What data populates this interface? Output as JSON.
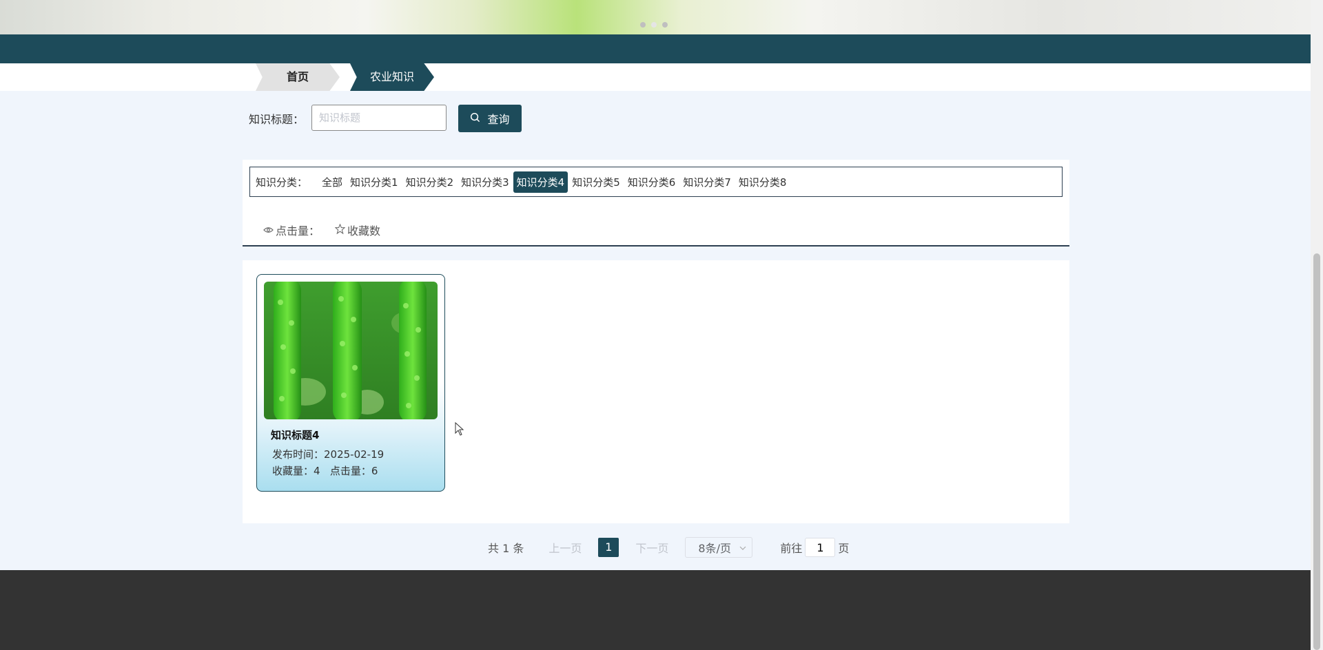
{
  "banner": {
    "slide_count": 3,
    "active_slide": 2
  },
  "breadcrumb": {
    "home": "首页",
    "current": "农业知识"
  },
  "search": {
    "label": "知识标题：",
    "placeholder": "知识标题",
    "value": "",
    "button_label": "查询"
  },
  "categories": {
    "label": "知识分类：",
    "items": [
      "全部",
      "知识分类1",
      "知识分类2",
      "知识分类3",
      "知识分类4",
      "知识分类5",
      "知识分类6",
      "知识分类7",
      "知识分类8"
    ],
    "active_index": 4
  },
  "sort": {
    "clicks": "点击量：",
    "favorites": "收藏数"
  },
  "card": {
    "title": "知识标题4",
    "publish_time": "发布时间：2025-02-19",
    "stats": "收藏量：4   点击量：6"
  },
  "pagination": {
    "total": "共 1 条",
    "prev": "上一页",
    "current_page": "1",
    "next": "下一页",
    "page_size": "8条/页",
    "goto_label": "前往",
    "goto_value": "1",
    "goto_suffix": "页"
  },
  "colors": {
    "primary": "#1d4b5a",
    "footer": "#333333",
    "page_bg": "#f0f5fc"
  }
}
